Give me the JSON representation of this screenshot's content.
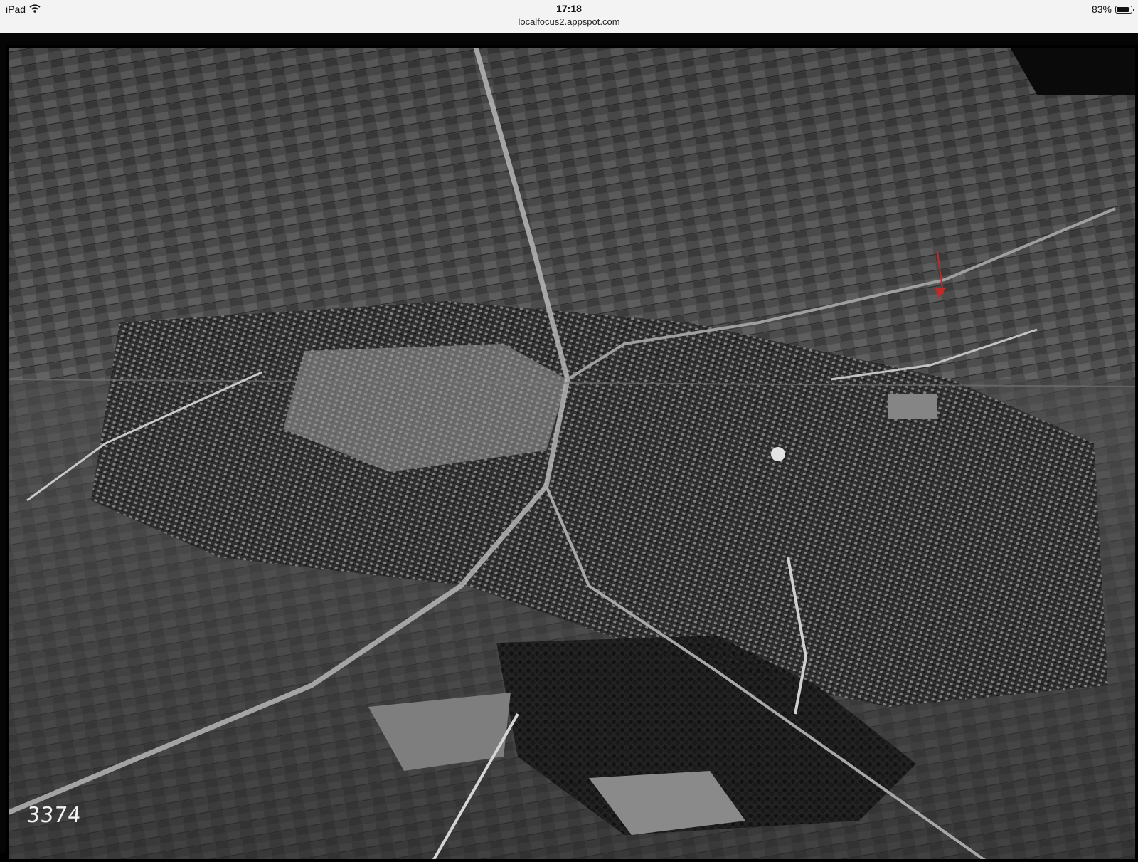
{
  "status_bar": {
    "device": "iPad",
    "time": "17:18",
    "battery_text": "83%",
    "battery_level": 0.83,
    "url": "localfocus2.appspot.com",
    "icons": [
      "wifi-icon",
      "battery-icon"
    ]
  },
  "photo": {
    "negative_number": "3374",
    "colors": {
      "dark": "#111111",
      "mid": "#6f6f6f",
      "light": "#d9d9d9",
      "arrow": "#c22a2a"
    }
  }
}
